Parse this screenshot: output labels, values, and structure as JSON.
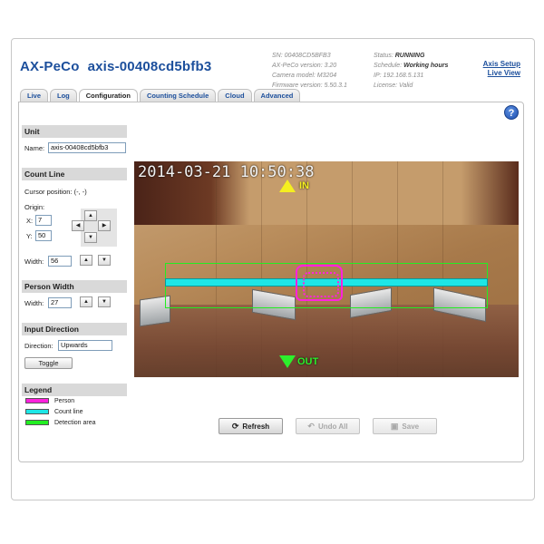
{
  "header": {
    "product": "AX-PeCo",
    "device": "axis-00408cd5bfb3",
    "info_left": [
      "SN: 00408CD5BFB3",
      "AX-PeCo version: 3.20",
      "Camera model: M3204",
      "Firmware version: 5.50.3.1"
    ],
    "status_label": "Status:",
    "status_value": "RUNNING",
    "schedule_label": "Schedule:",
    "schedule_value": "Working hours",
    "ip": "IP: 192.168.5.131",
    "license": "License: Valid",
    "link_setup": "Axis Setup",
    "link_live": "Live View"
  },
  "tabs": [
    {
      "label": "Live"
    },
    {
      "label": "Log"
    },
    {
      "label": "Configuration",
      "active": true
    },
    {
      "label": "Counting Schedule"
    },
    {
      "label": "Cloud"
    },
    {
      "label": "Advanced"
    }
  ],
  "help": "?",
  "unit": {
    "heading": "Unit",
    "name_label": "Name:",
    "name_value": "axis-00408cd5bfb3"
  },
  "count_line": {
    "heading": "Count Line",
    "cursor": "Cursor position: (-, -)",
    "origin_label": "Origin:",
    "x_label": "X:",
    "x_value": "7",
    "y_label": "Y:",
    "y_value": "50",
    "width_label": "Width:",
    "width_value": "56"
  },
  "person_width": {
    "heading": "Person Width",
    "width_label": "Width:",
    "width_value": "27"
  },
  "input_direction": {
    "heading": "Input Direction",
    "direction_label": "Direction:",
    "direction_value": "Upwards",
    "toggle": "Toggle"
  },
  "legend": {
    "heading": "Legend",
    "items": [
      {
        "label": "Person",
        "color": "#ff22dd"
      },
      {
        "label": "Count line",
        "color": "#1ee6e6"
      },
      {
        "label": "Detection area",
        "color": "#22ee22"
      }
    ]
  },
  "video": {
    "timestamp": "2014-03-21 10:50:38",
    "in_label": "IN",
    "out_label": "OUT"
  },
  "actions": {
    "refresh": "Refresh",
    "undo_all": "Undo All",
    "save": "Save"
  }
}
